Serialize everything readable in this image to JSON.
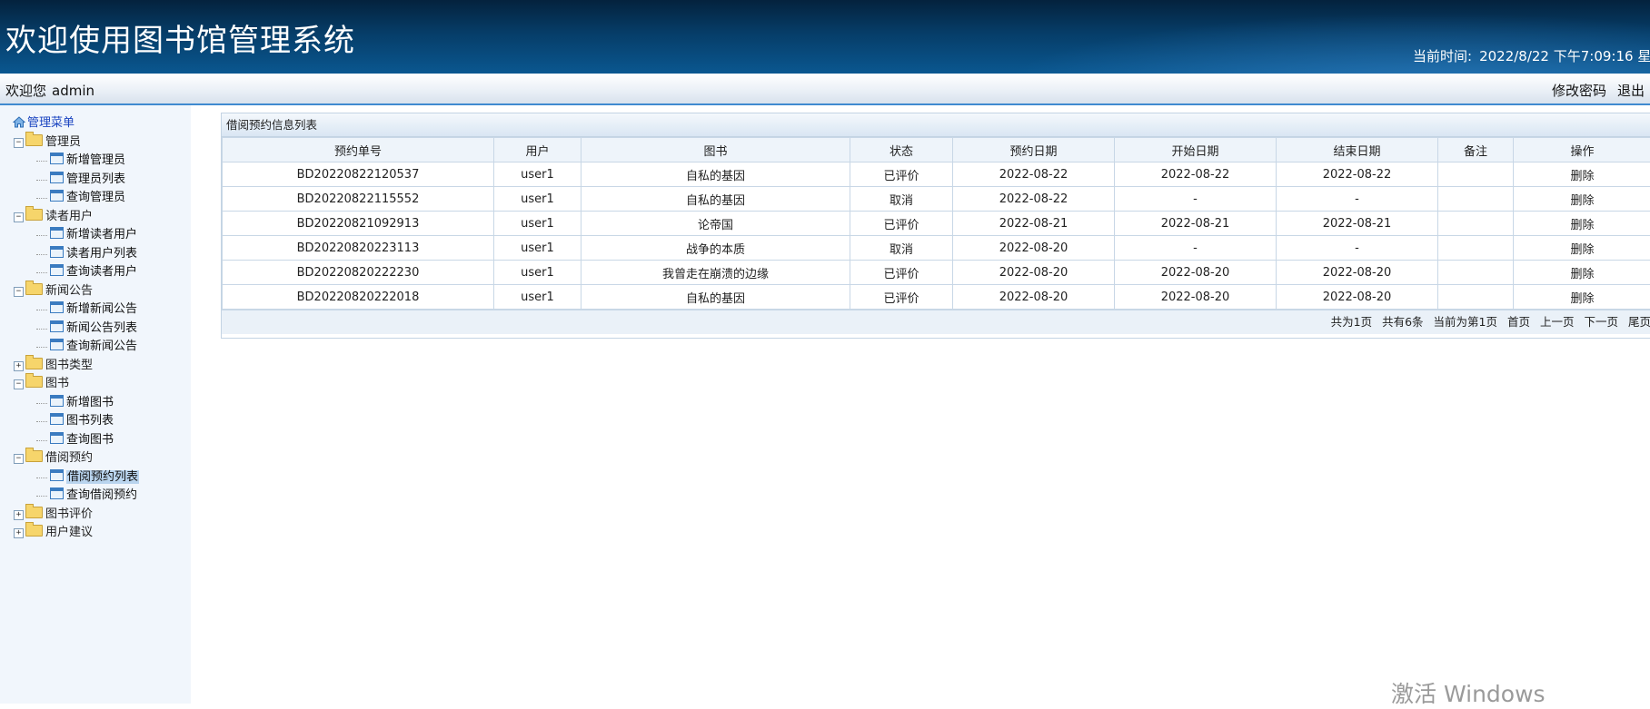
{
  "header": {
    "title": "欢迎使用图书馆管理系统",
    "time_label": "当前时间:",
    "time_value": "2022/8/22 下午7:09:16 星"
  },
  "topbar": {
    "welcome": "欢迎您",
    "username": "admin",
    "change_password": "修改密码",
    "logout": "退出"
  },
  "sidebar": {
    "root": "管理菜单",
    "groups": [
      {
        "label": "管理员",
        "expanded": true,
        "items": [
          "新增管理员",
          "管理员列表",
          "查询管理员"
        ]
      },
      {
        "label": "读者用户",
        "expanded": true,
        "items": [
          "新增读者用户",
          "读者用户列表",
          "查询读者用户"
        ]
      },
      {
        "label": "新闻公告",
        "expanded": true,
        "items": [
          "新增新闻公告",
          "新闻公告列表",
          "查询新闻公告"
        ]
      },
      {
        "label": "图书类型",
        "expanded": false,
        "items": []
      },
      {
        "label": "图书",
        "expanded": true,
        "items": [
          "新增图书",
          "图书列表",
          "查询图书"
        ]
      },
      {
        "label": "借阅预约",
        "expanded": true,
        "items": [
          "借阅预约列表",
          "查询借阅预约"
        ],
        "selected": "借阅预约列表"
      },
      {
        "label": "图书评价",
        "expanded": false,
        "items": []
      },
      {
        "label": "用户建议",
        "expanded": false,
        "items": []
      }
    ]
  },
  "main": {
    "caption": "借阅预约信息列表",
    "columns": [
      "预约单号",
      "用户",
      "图书",
      "状态",
      "预约日期",
      "开始日期",
      "结束日期",
      "备注",
      "操作"
    ],
    "rows": [
      [
        "BD20220822120537",
        "user1",
        "自私的基因",
        "已评价",
        "2022-08-22",
        "2022-08-22",
        "2022-08-22",
        "",
        "删除"
      ],
      [
        "BD20220822115552",
        "user1",
        "自私的基因",
        "取消",
        "2022-08-22",
        "-",
        "-",
        "",
        "删除"
      ],
      [
        "BD20220821092913",
        "user1",
        "论帝国",
        "已评价",
        "2022-08-21",
        "2022-08-21",
        "2022-08-21",
        "",
        "删除"
      ],
      [
        "BD20220820223113",
        "user1",
        "战争的本质",
        "取消",
        "2022-08-20",
        "-",
        "-",
        "",
        "删除"
      ],
      [
        "BD20220820222230",
        "user1",
        "我曾走在崩溃的边缘",
        "已评价",
        "2022-08-20",
        "2022-08-20",
        "2022-08-20",
        "",
        "删除"
      ],
      [
        "BD20220820222018",
        "user1",
        "自私的基因",
        "已评价",
        "2022-08-20",
        "2022-08-20",
        "2022-08-20",
        "",
        "删除"
      ]
    ],
    "pager": {
      "total_pages": "共为1页",
      "total_records": "共有6条",
      "current": "当前为第1页",
      "first": "首页",
      "prev": "上一页",
      "next": "下一页",
      "last": "尾页"
    }
  },
  "watermark": "激活 Windows",
  "colors": {
    "header_dark": "#04223d",
    "header_light": "#0a5790",
    "accent_line": "#3f8ad0",
    "sidebar_bg": "#f1f6fc",
    "selected_bg": "#b9d4ee"
  }
}
